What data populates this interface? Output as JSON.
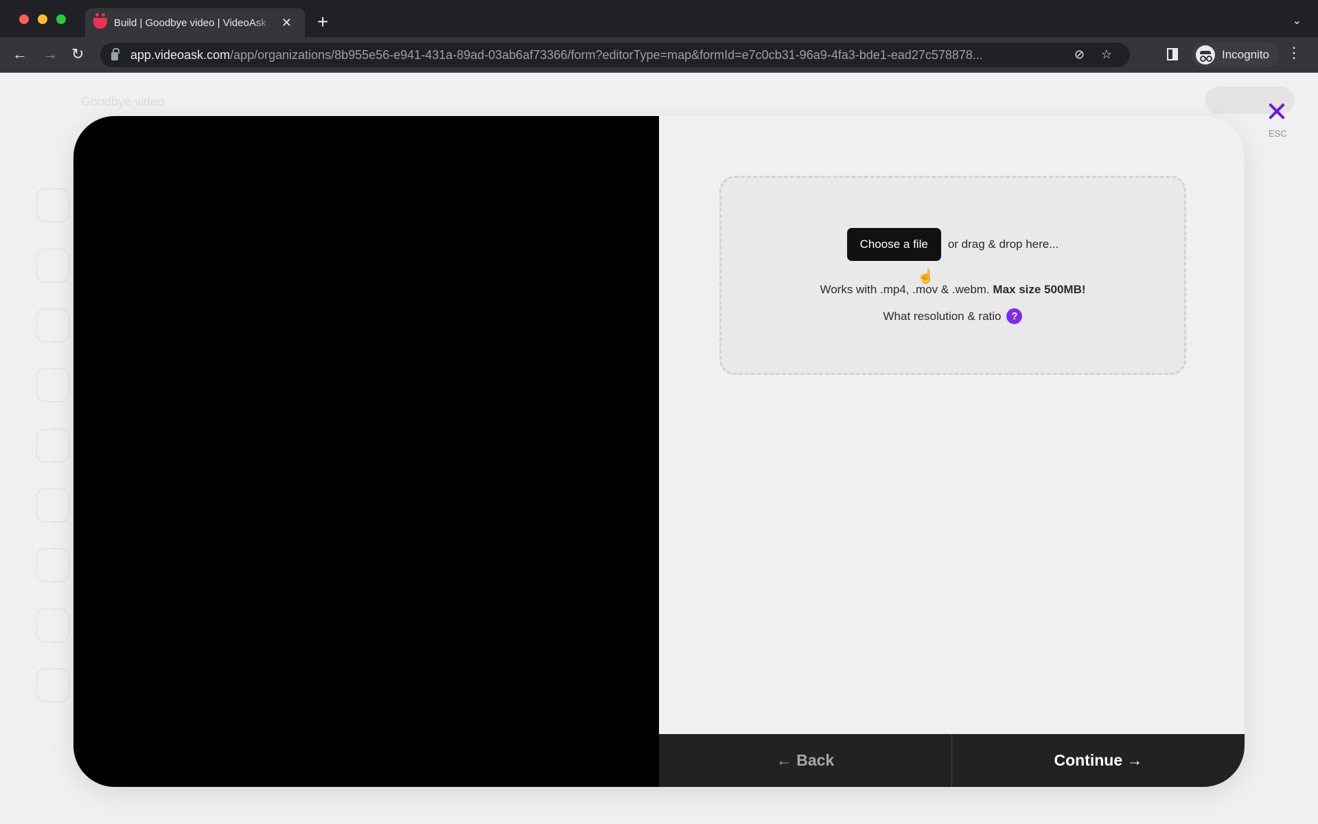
{
  "browser": {
    "tab_title": "Build | Goodbye video | VideoAsk",
    "url_host": "app.videoask.com",
    "url_path": "/app/organizations/8b955e56-e941-431a-89ad-03ab6af73366/form?editorType=map&formId=e7c0cb31-96a9-4fa3-bde1-ead27c578878...",
    "profile_label": "Incognito",
    "icons": {
      "back": "←",
      "forward": "→",
      "reload": "↻",
      "close_tab": "✕",
      "new_tab": "+",
      "tab_search": "⌄",
      "eye_off": "⊘",
      "star": "☆",
      "menu": "⋮"
    }
  },
  "background_app": {
    "title": "Goodbye video"
  },
  "modal": {
    "close_hint": "ESC",
    "upload": {
      "choose_label": "Choose a file",
      "drag_text": "or drag & drop here...",
      "formats_text": "Works with .mp4, .mov & .webm.",
      "max_size_text": "Max size 500MB!",
      "help_text": "What resolution & ratio",
      "help_icon": "?"
    },
    "footer": {
      "back_label": "← Back",
      "continue_label": "Continue →"
    }
  },
  "colors": {
    "accent": "#6a1be0",
    "help_badge": "#7b2cf0",
    "footer_bg": "#222222"
  }
}
